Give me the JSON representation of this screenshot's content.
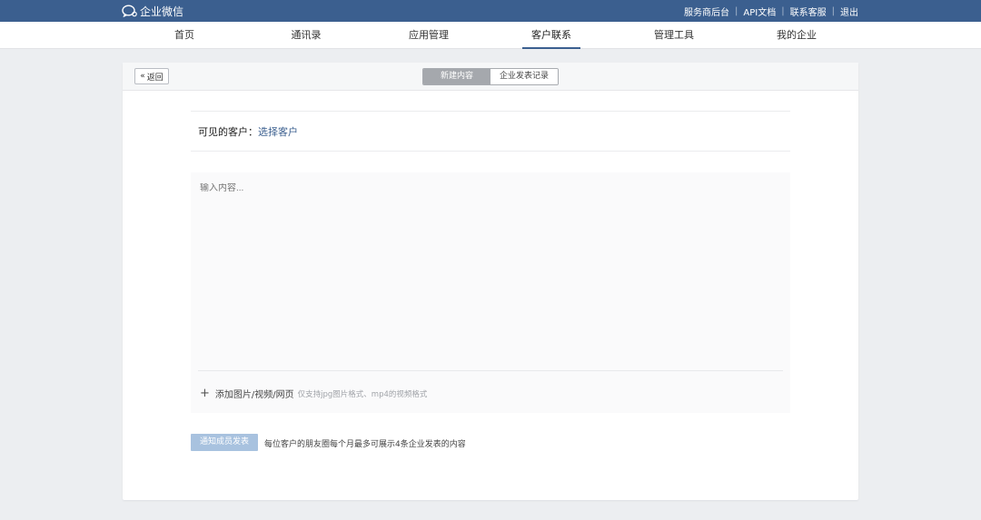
{
  "topbar": {
    "brand": "企业微信",
    "links": [
      "服务商后台",
      "API文档",
      "联系客服",
      "退出"
    ]
  },
  "nav": {
    "items": [
      "首页",
      "通讯录",
      "应用管理",
      "客户联系",
      "管理工具",
      "我的企业"
    ],
    "active_index": 3
  },
  "card": {
    "back_label": "返回",
    "tabs": [
      "新建内容",
      "企业发表记录"
    ],
    "active_tab_index": 0,
    "visible_label": "可见的客户：",
    "select_link": "选择客户",
    "editor_placeholder": "输入内容...",
    "add_media_label": "添加图片/视频/网页",
    "add_media_hint": "仅支持jpg图片格式、mp4的视频格式",
    "notify_button": "通知成员发表",
    "notify_hint": "每位客户的朋友圈每个月最多可展示4条企业发表的内容"
  },
  "colors": {
    "topbar_bg": "#3b5f8f",
    "accent": "#3b5f8f",
    "page_bg": "#eceef1",
    "notify_button_bg": "#a8c2df"
  },
  "icons": {
    "brand": "chat-bubble-icon",
    "back": "chevron-left-icon",
    "add": "plus-icon"
  }
}
